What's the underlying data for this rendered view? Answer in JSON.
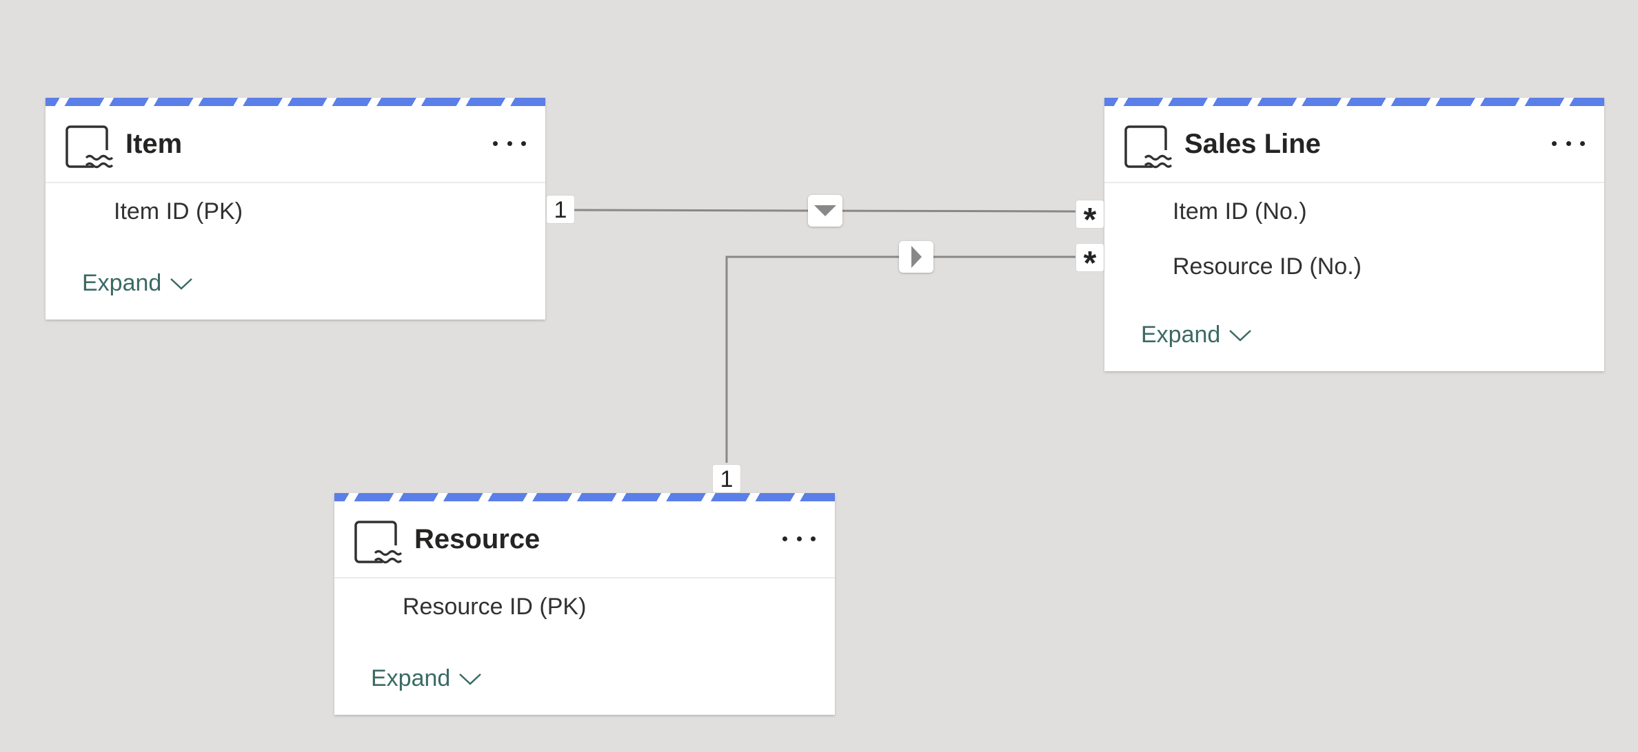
{
  "tables": [
    {
      "title": "Item",
      "icon": "lakehouse-table-icon",
      "fields": [
        "Item ID (PK)"
      ],
      "expand_label": "Expand"
    },
    {
      "title": "Sales Line",
      "icon": "lakehouse-table-icon",
      "fields": [
        "Item ID (No.)",
        "Resource ID (No.)"
      ],
      "expand_label": "Expand"
    },
    {
      "title": "Resource",
      "icon": "lakehouse-table-icon",
      "fields": [
        "Resource ID (PK)"
      ],
      "expand_label": "Expand"
    }
  ],
  "relationships": [
    {
      "from_table": "Item",
      "to_table": "Sales Line",
      "from_cardinality": "1",
      "to_cardinality": "*",
      "direction_icon": "triangle-down-icon"
    },
    {
      "from_table": "Resource",
      "to_table": "Sales Line",
      "from_cardinality": "1",
      "to_cardinality": "*",
      "direction_icon": "triangle-right-icon"
    }
  ],
  "colors": {
    "canvas": "#e1dfdd",
    "card_stripe": "#5b7fe8",
    "expand_text": "#3b6a63",
    "connector": "#8a8886"
  }
}
